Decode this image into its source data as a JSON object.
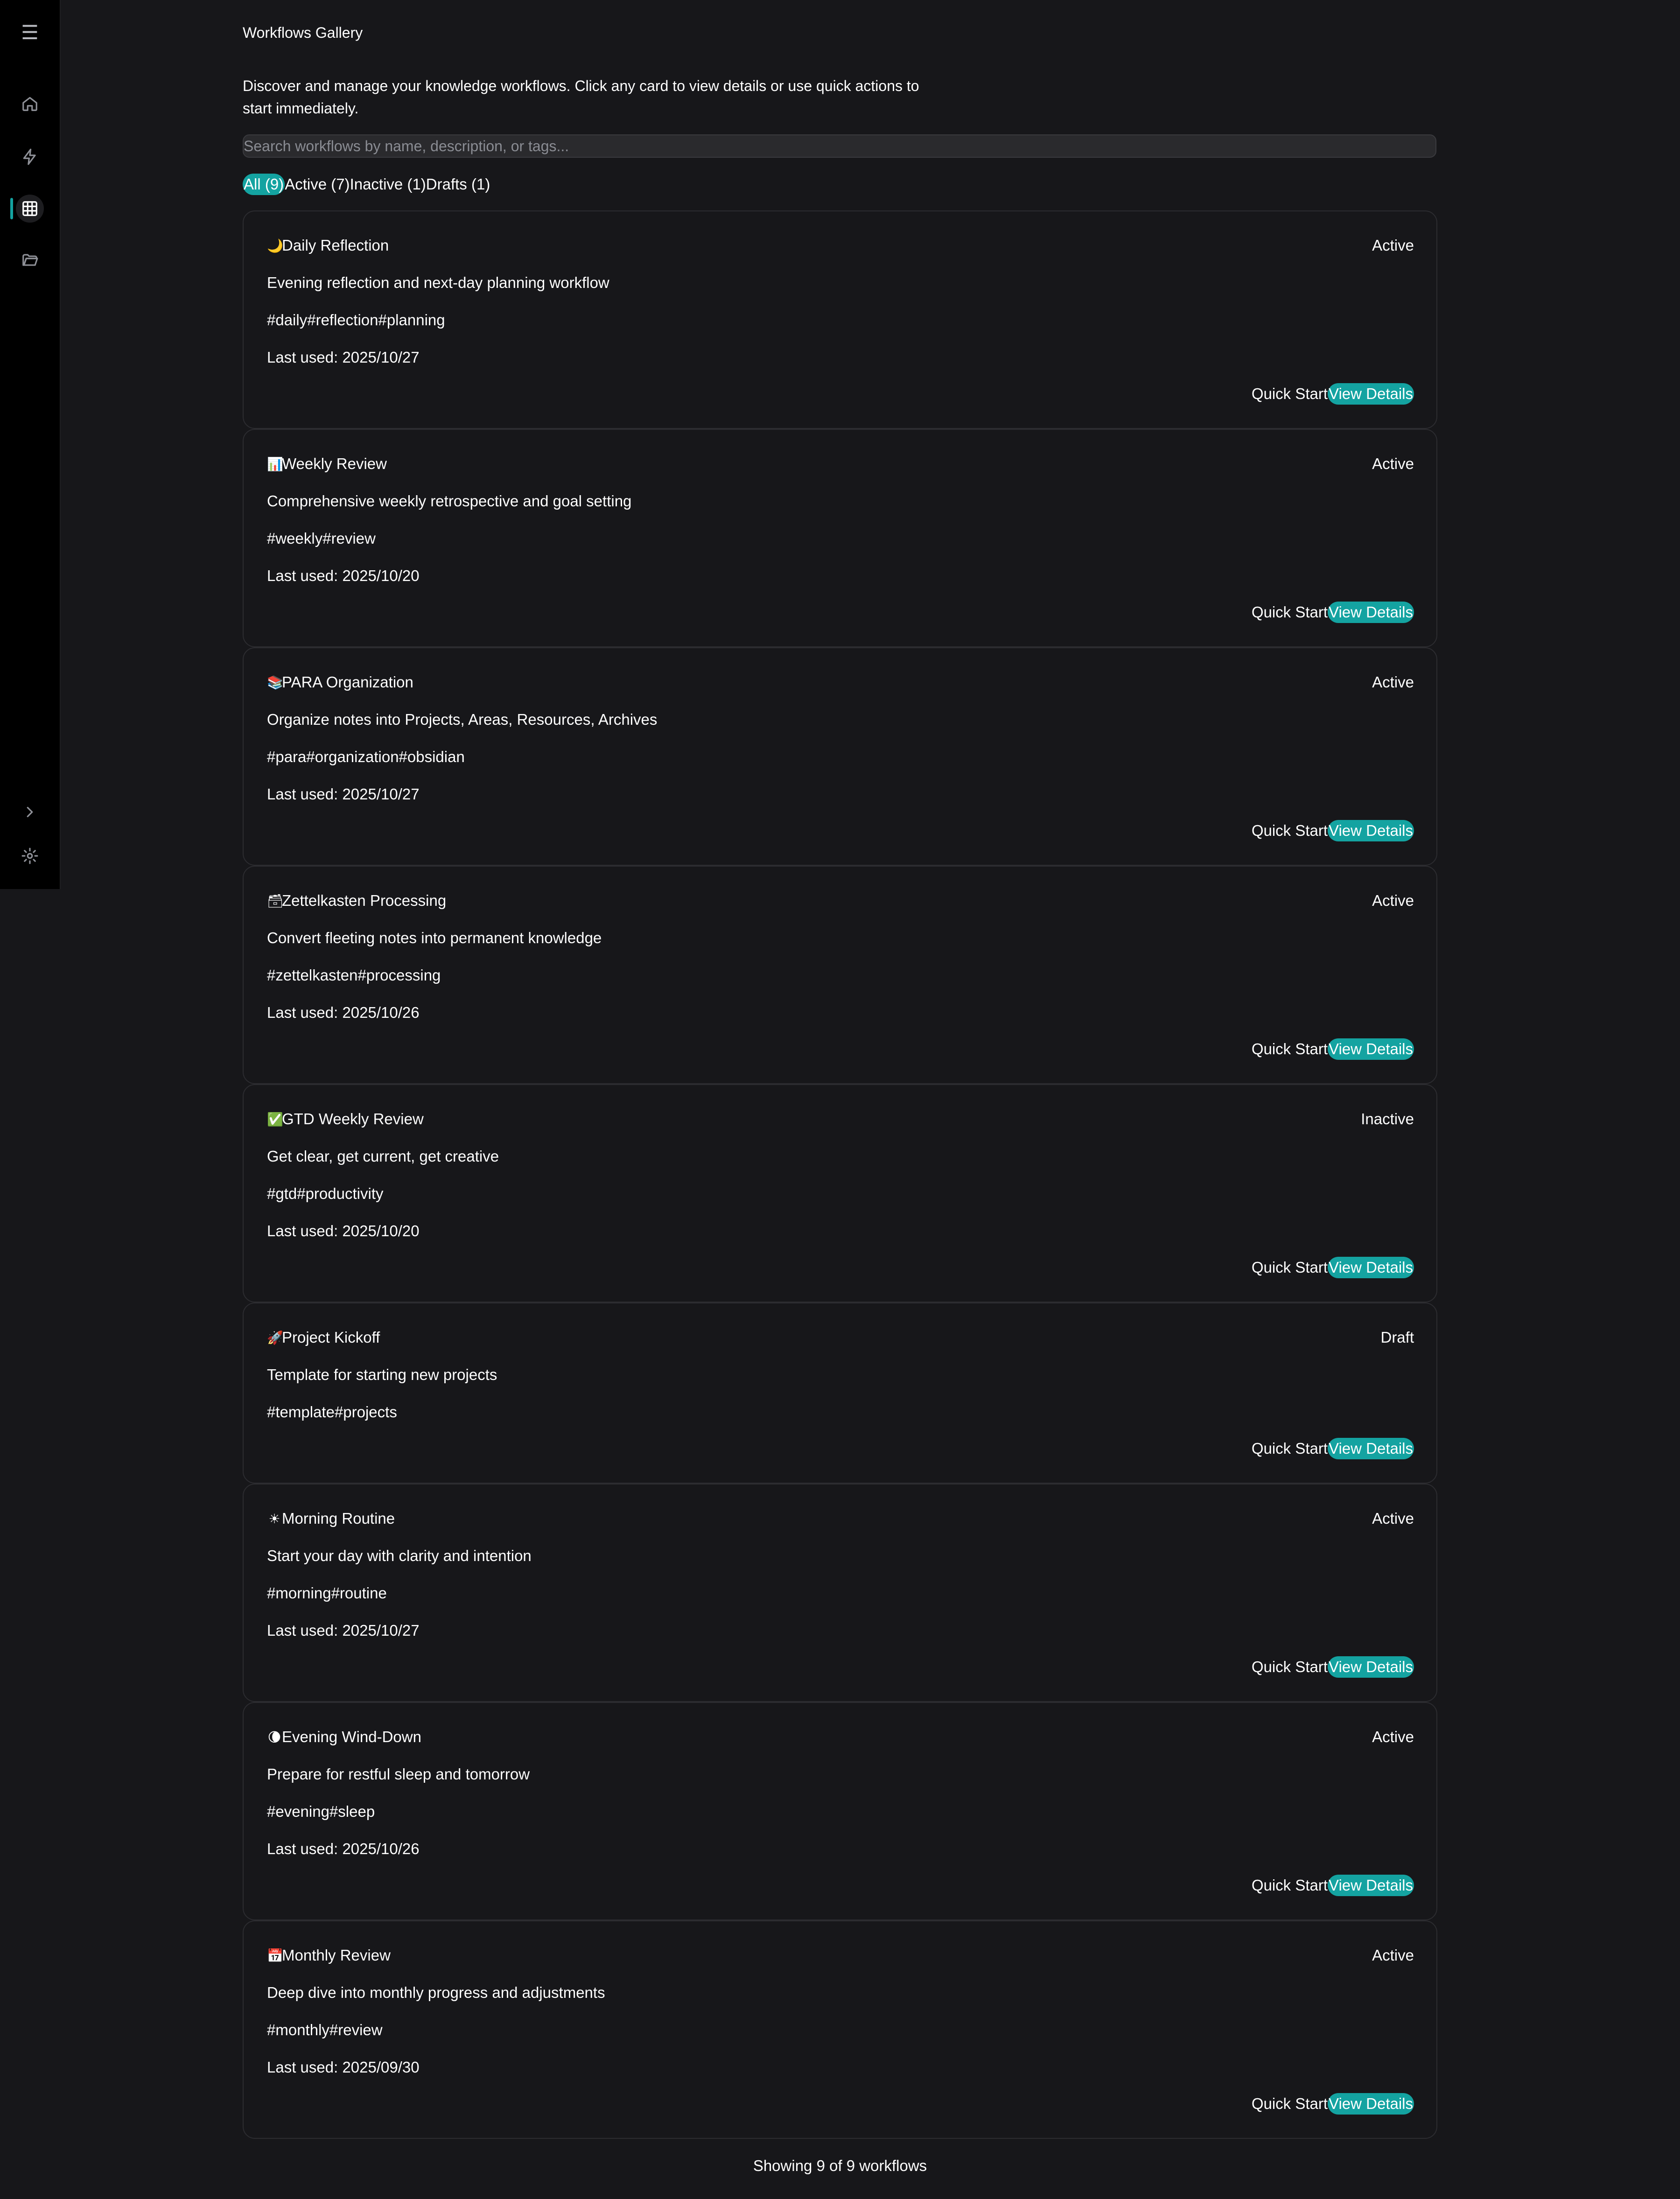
{
  "header": {
    "title": "Workflows Gallery",
    "description": "Discover and manage your knowledge workflows. Click any card to view details or use quick actions to start immediately."
  },
  "search": {
    "placeholder": "Search workflows by name, description, or tags..."
  },
  "filters": [
    {
      "label": "All (9)"
    },
    {
      "label": "Active (7)"
    },
    {
      "label": "Inactive (1)"
    },
    {
      "label": "Drafts (1)"
    }
  ],
  "sidebar": {
    "menu_glyph": "☰",
    "items": [
      "home-icon",
      "lightning-icon",
      "grid-icon",
      "folder-icon"
    ],
    "bottom": [
      "chevron-right-icon",
      "gear-icon"
    ]
  },
  "colors": {
    "accent": "#14a3a1",
    "background": "#17171a",
    "sidebar": "#000000",
    "border": "#2c2c30"
  },
  "actions": {
    "quick_start": "Quick Start",
    "view_details": "View Details"
  },
  "workflows": [
    {
      "emoji": "🌙",
      "name": "Daily Reflection",
      "status": "Active",
      "description": "Evening reflection and next-day planning workflow",
      "tags": "#daily#reflection#planning",
      "last_used": "Last used: 2025/10/27"
    },
    {
      "emoji": "📊",
      "name": "Weekly Review",
      "status": "Active",
      "description": "Comprehensive weekly retrospective and goal setting",
      "tags": "#weekly#review",
      "last_used": "Last used: 2025/10/20"
    },
    {
      "emoji": "📚",
      "name": "PARA Organization",
      "status": "Active",
      "description": "Organize notes into Projects, Areas, Resources, Archives",
      "tags": "#para#organization#obsidian",
      "last_used": "Last used: 2025/10/27"
    },
    {
      "emoji": "🗃",
      "name": "Zettelkasten Processing",
      "status": "Active",
      "description": "Convert fleeting notes into permanent knowledge",
      "tags": "#zettelkasten#processing",
      "last_used": "Last used: 2025/10/26"
    },
    {
      "emoji": "✅",
      "name": "GTD Weekly Review",
      "status": "Inactive",
      "description": "Get clear, get current, get creative",
      "tags": "#gtd#productivity",
      "last_used": "Last used: 2025/10/20"
    },
    {
      "emoji": "🚀",
      "name": "Project Kickoff",
      "status": "Draft",
      "description": "Template for starting new projects",
      "tags": "#template#projects",
      "last_used": ""
    },
    {
      "emoji": "☀",
      "name": "Morning Routine",
      "status": "Active",
      "description": "Start your day with clarity and intention",
      "tags": "#morning#routine",
      "last_used": "Last used: 2025/10/27"
    },
    {
      "emoji": "🌘",
      "name": "Evening Wind-Down",
      "status": "Active",
      "description": "Prepare for restful sleep and tomorrow",
      "tags": "#evening#sleep",
      "last_used": "Last used: 2025/10/26"
    },
    {
      "emoji": "📅",
      "name": "Monthly Review",
      "status": "Active",
      "description": "Deep dive into monthly progress and adjustments",
      "tags": "#monthly#review",
      "last_used": "Last used: 2025/09/30"
    }
  ],
  "footer": "Showing 9 of 9 workflows"
}
